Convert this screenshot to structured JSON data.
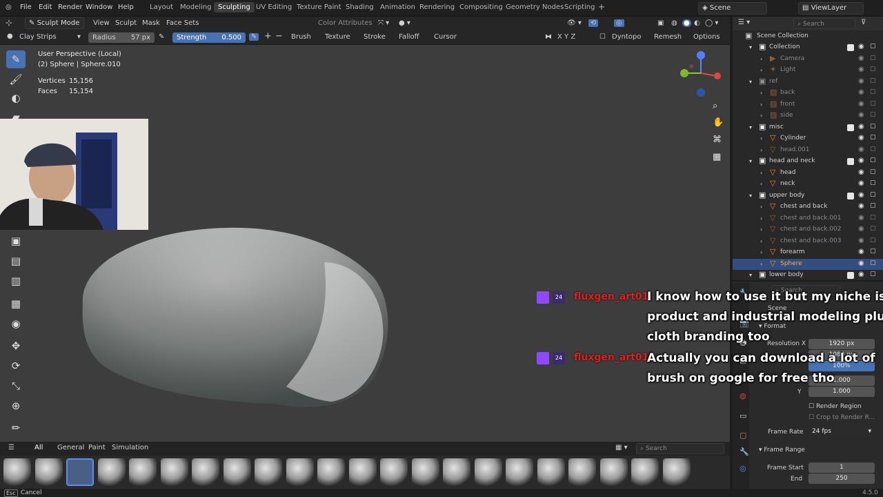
{
  "menu": {
    "items": [
      "File",
      "Edit",
      "Render",
      "Window",
      "Help"
    ],
    "workspaces": [
      "Layout",
      "Modeling",
      "Sculpting",
      "UV Editing",
      "Texture Paint",
      "Shading",
      "Animation",
      "Rendering",
      "Compositing",
      "Geometry Nodes",
      "Scripting"
    ],
    "active_workspace": "Sculpting",
    "scene": "Scene",
    "view_layer": "ViewLayer"
  },
  "header": {
    "mode": "Sculpt Mode",
    "view": "View",
    "sculpt": "Sculpt",
    "mask": "Mask",
    "face_sets": "Face Sets",
    "color_attributes": "Color Attributes"
  },
  "tool_settings": {
    "brush_name": "Clay Strips",
    "radius_label": "Radius",
    "radius_value": "57 px",
    "strength_label": "Strength",
    "strength_value": "0.500",
    "brush_menu": "Brush",
    "texture_menu": "Texture",
    "stroke_menu": "Stroke",
    "falloff_menu": "Falloff",
    "cursor_menu": "Cursor",
    "axes": "X Y Z",
    "dyntopo": "Dyntopo",
    "remesh": "Remesh",
    "options": "Options"
  },
  "viewport": {
    "perspective": "User Perspective (Local)",
    "object": "(2) Sphere | Sphere.010",
    "vertices_label": "Vertices",
    "vertices_value": "15,156",
    "faces_label": "Faces",
    "faces_value": "15,154"
  },
  "outliner": {
    "search_placeholder": "Search",
    "scene_collection": "Scene Collection",
    "rows": [
      {
        "label": "Collection",
        "type": "collection",
        "level": 1
      },
      {
        "label": "Camera",
        "type": "camera",
        "level": 2,
        "dim": true
      },
      {
        "label": "Light",
        "type": "light",
        "level": 2,
        "dim": true
      },
      {
        "label": "ref",
        "type": "collection",
        "level": 1,
        "dim": true
      },
      {
        "label": "back",
        "type": "image",
        "level": 2,
        "dim": true
      },
      {
        "label": "front",
        "type": "image",
        "level": 2,
        "dim": true
      },
      {
        "label": "side",
        "type": "image",
        "level": 2,
        "dim": true
      },
      {
        "label": "misc",
        "type": "collection",
        "level": 1
      },
      {
        "label": "Cylinder",
        "type": "mesh",
        "level": 2
      },
      {
        "label": "head.001",
        "type": "mesh",
        "level": 2,
        "dim": true
      },
      {
        "label": "head and neck",
        "type": "collection",
        "level": 1
      },
      {
        "label": "head",
        "type": "mesh",
        "level": 2
      },
      {
        "label": "neck",
        "type": "mesh",
        "level": 2
      },
      {
        "label": "upper body",
        "type": "collection",
        "level": 1
      },
      {
        "label": "chest and back",
        "type": "mesh",
        "level": 2
      },
      {
        "label": "chest and back.001",
        "type": "mesh",
        "level": 2,
        "dim": true
      },
      {
        "label": "chest and back.002",
        "type": "mesh",
        "level": 2,
        "dim": true
      },
      {
        "label": "chest and back.003",
        "type": "mesh",
        "level": 2,
        "dim": true
      },
      {
        "label": "forearm",
        "type": "mesh",
        "level": 2
      },
      {
        "label": "Sphere",
        "type": "mesh",
        "level": 2,
        "selected": true
      },
      {
        "label": "lower body",
        "type": "collection",
        "level": 1
      }
    ]
  },
  "properties": {
    "search_placeholder": "Search",
    "scene_label": "Scene",
    "format_label": "Format",
    "resolution_x_label": "Resolution X",
    "resolution_x_value": "1920 px",
    "resolution_y_value": "1080 px",
    "resolution_pct_value": "100%",
    "aspect_x_value": "1.000",
    "y_label": "Y",
    "aspect_y_value": "1.000",
    "render_region": "Render Region",
    "crop_region": "Crop to Render R...",
    "frame_rate_label": "Frame Rate",
    "frame_rate_value": "24 fps",
    "frame_range_label": "Frame Range",
    "frame_start_label": "Frame Start",
    "frame_start_value": "1",
    "end_label": "End",
    "end_value": "250"
  },
  "shelf": {
    "tabs": [
      "All",
      "General",
      "Paint",
      "Simulation"
    ],
    "search_placeholder": "Search"
  },
  "status": {
    "key": "Esc",
    "action": "Cancel",
    "version": "4.5.0"
  },
  "chat": {
    "messages": [
      {
        "user": "fluxgen_art01",
        "lines": [
          "I know how to use it but my niche is",
          "product and industrial modeling plus",
          "cloth branding too"
        ]
      },
      {
        "user": "fluxgen_art01",
        "lines": [
          "Actually you can download a lot of",
          "brush on google for free tho"
        ]
      }
    ]
  },
  "colors": {
    "accent": "#4772b3",
    "selected_row": "#334d80",
    "mesh_icon": "#e8883a",
    "chat_user": "#e0201f"
  }
}
